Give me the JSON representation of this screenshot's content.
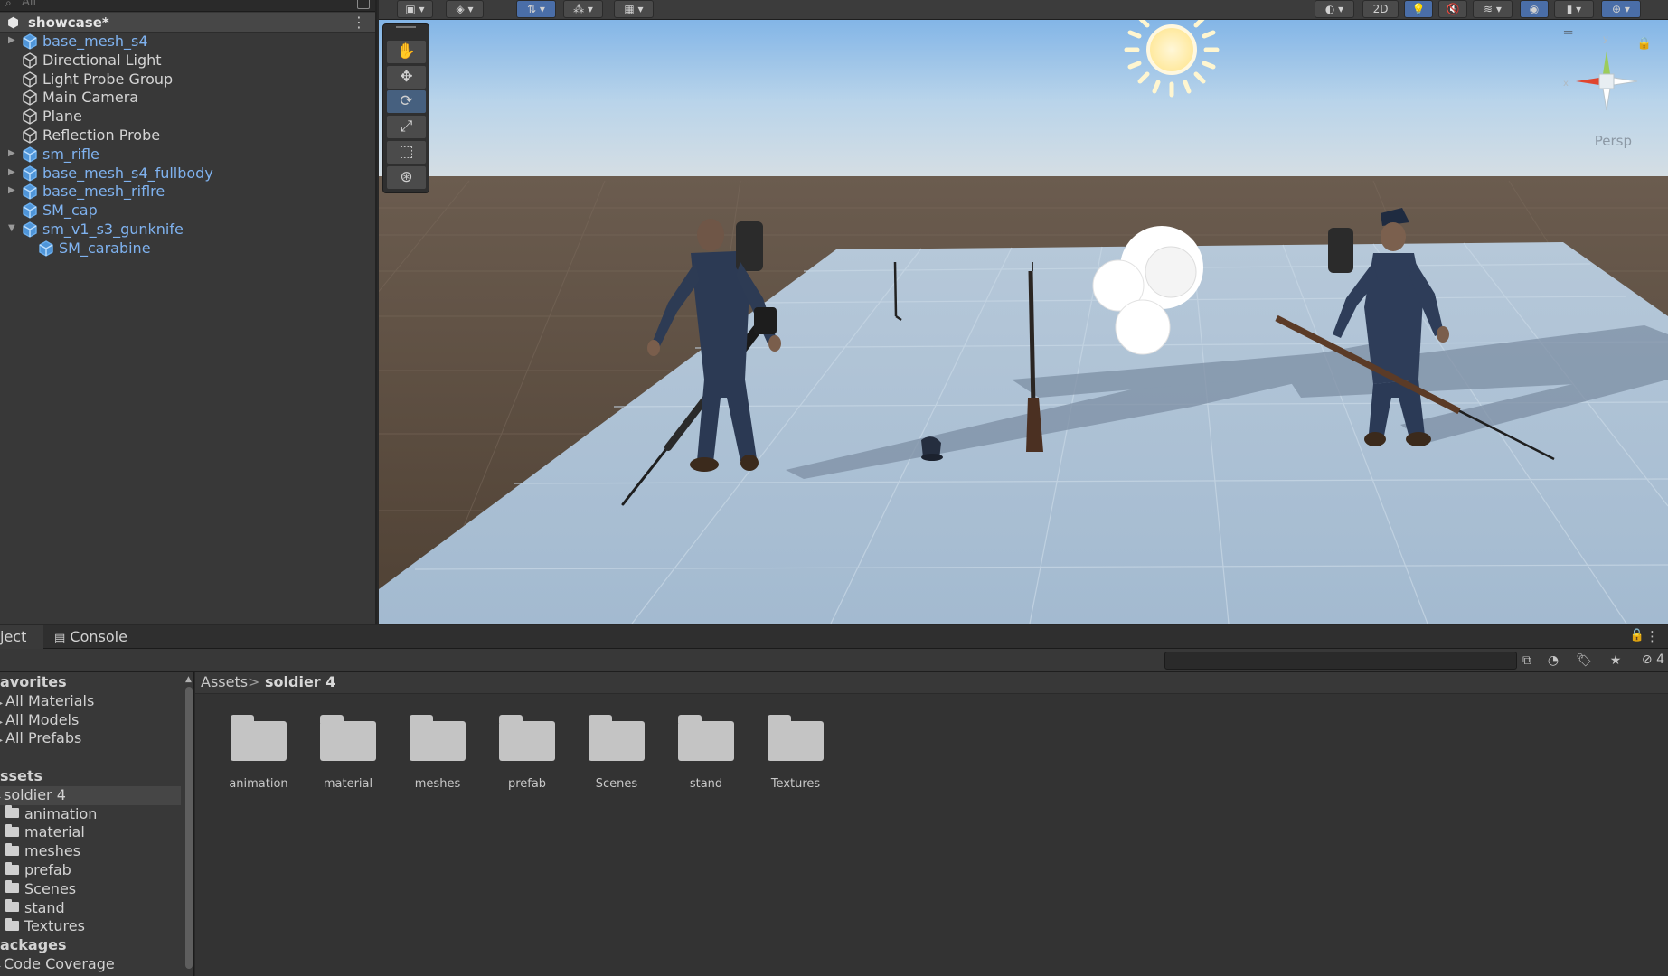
{
  "hierarchy": {
    "search_placeholder": "All",
    "scene_name": "showcase*",
    "items": [
      {
        "label": "base_mesh_s4",
        "prefab": true,
        "expandable": true,
        "expanded": false,
        "depth": 0
      },
      {
        "label": "Directional Light",
        "prefab": false,
        "expandable": false,
        "depth": 0
      },
      {
        "label": "Light Probe Group",
        "prefab": false,
        "expandable": false,
        "depth": 0
      },
      {
        "label": "Main Camera",
        "prefab": false,
        "expandable": false,
        "depth": 0
      },
      {
        "label": "Plane",
        "prefab": false,
        "expandable": false,
        "depth": 0
      },
      {
        "label": "Reflection Probe",
        "prefab": false,
        "expandable": false,
        "depth": 0
      },
      {
        "label": "sm_rifle",
        "prefab": true,
        "expandable": true,
        "expanded": false,
        "depth": 0
      },
      {
        "label": "base_mesh_s4_fullbody",
        "prefab": true,
        "expandable": true,
        "expanded": false,
        "depth": 0
      },
      {
        "label": "base_mesh_riflre",
        "prefab": true,
        "expandable": true,
        "expanded": false,
        "depth": 0
      },
      {
        "label": "SM_cap",
        "prefab": true,
        "expandable": false,
        "depth": 0
      },
      {
        "label": "sm_v1_s3_gunknife",
        "prefab": true,
        "expandable": true,
        "expanded": true,
        "depth": 0
      },
      {
        "label": "SM_carabine",
        "prefab": true,
        "expandable": false,
        "depth": 1
      }
    ]
  },
  "scene": {
    "toolbar": {
      "mode_2d": "2D"
    },
    "camera_label": "Persp",
    "tools": [
      "view-tool",
      "move-tool",
      "rotate-tool",
      "scale-tool",
      "rect-tool",
      "transform-tool"
    ],
    "active_tool": "rotate-tool"
  },
  "project": {
    "tabs": [
      {
        "label": "ject",
        "icon": "folder-icon",
        "active": true
      },
      {
        "label": "Console",
        "icon": "console-icon",
        "active": false
      }
    ],
    "search_value": "",
    "hidden_count": "4",
    "tree": {
      "favorites_label": "avorites",
      "favorites": [
        "All Materials",
        "All Models",
        "All Prefabs"
      ],
      "assets_label": "ssets",
      "selected": "soldier 4",
      "folders": [
        "animation",
        "material",
        "meshes",
        "prefab",
        "Scenes",
        "stand",
        "Textures"
      ],
      "packages_label": "ackages",
      "packages": [
        "Code Coverage"
      ]
    },
    "breadcrumb": {
      "root": "Assets",
      "separator": ">",
      "current": "soldier 4"
    },
    "assets": [
      "animation",
      "material",
      "meshes",
      "prefab",
      "Scenes",
      "stand",
      "Textures"
    ]
  },
  "colors": {
    "prefab_text": "#7fb2ef",
    "active_tool": "#46607f",
    "sky_top": "#7fb4e6",
    "plane": "#a9bfd6",
    "ground": "#5c4c3d"
  }
}
